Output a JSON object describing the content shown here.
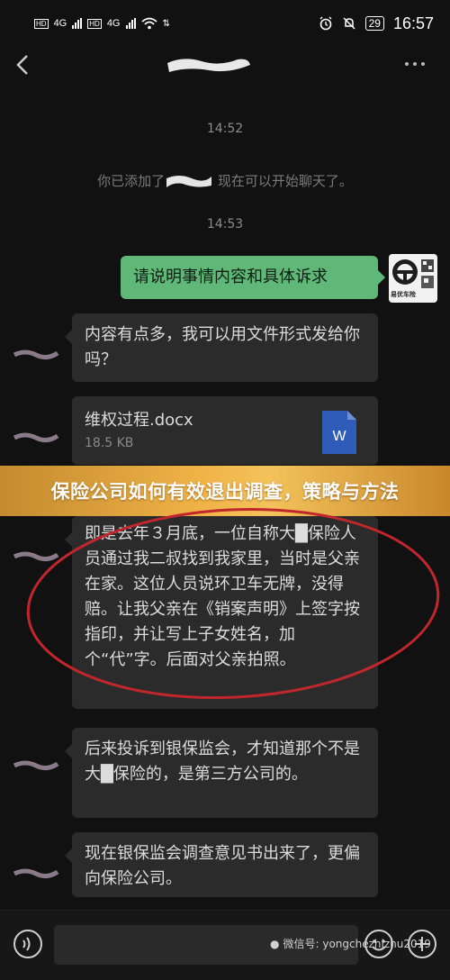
{
  "status_bar": {
    "network_1": "4G",
    "network_2": "4G",
    "clock": "16:57",
    "battery": "29"
  },
  "chat": {
    "time_1": "14:52",
    "system_prefix": "你已添加了",
    "system_suffix": "现在可以开始聊天了。",
    "time_2": "14:53",
    "messages": [
      {
        "side": "right",
        "text": "请说明事情内容和具体诉求"
      },
      {
        "side": "left",
        "text": "内容有点多，我可以用文件形式发给你吗？"
      },
      {
        "side": "left",
        "text": "即是去年３月底，一位自称大█保险人员通过我二叔找到我家里，当时是父亲在家。这位人员说环卫车无牌，没得赔。让我父亲在《销案声明》上签字按指印，并让写上子女姓名，加个“代”字。后面对父亲拍照。"
      },
      {
        "side": "left",
        "text": "后来投诉到银保监会，才知道那个不是大█保险的，是第三方公司的。"
      },
      {
        "side": "left",
        "text": "现在银保监会调查意见书出来了，更偏向保险公司。"
      }
    ],
    "file": {
      "name": "维权过程.docx",
      "size": "18.5 KB",
      "icon_letter": "W"
    },
    "avatar_caption": "易优车险"
  },
  "banner": {
    "title": "保险公司如何有效退出调查，策略与方法"
  },
  "input_bar": {
    "watermark": "微信号: yongchezhizhu2019"
  },
  "colors": {
    "sent_bubble": "#5fb878",
    "received_bubble": "#2b2b2b",
    "background": "#111111",
    "annotation_ring": "#c0272d",
    "banner": "#f0b347"
  }
}
